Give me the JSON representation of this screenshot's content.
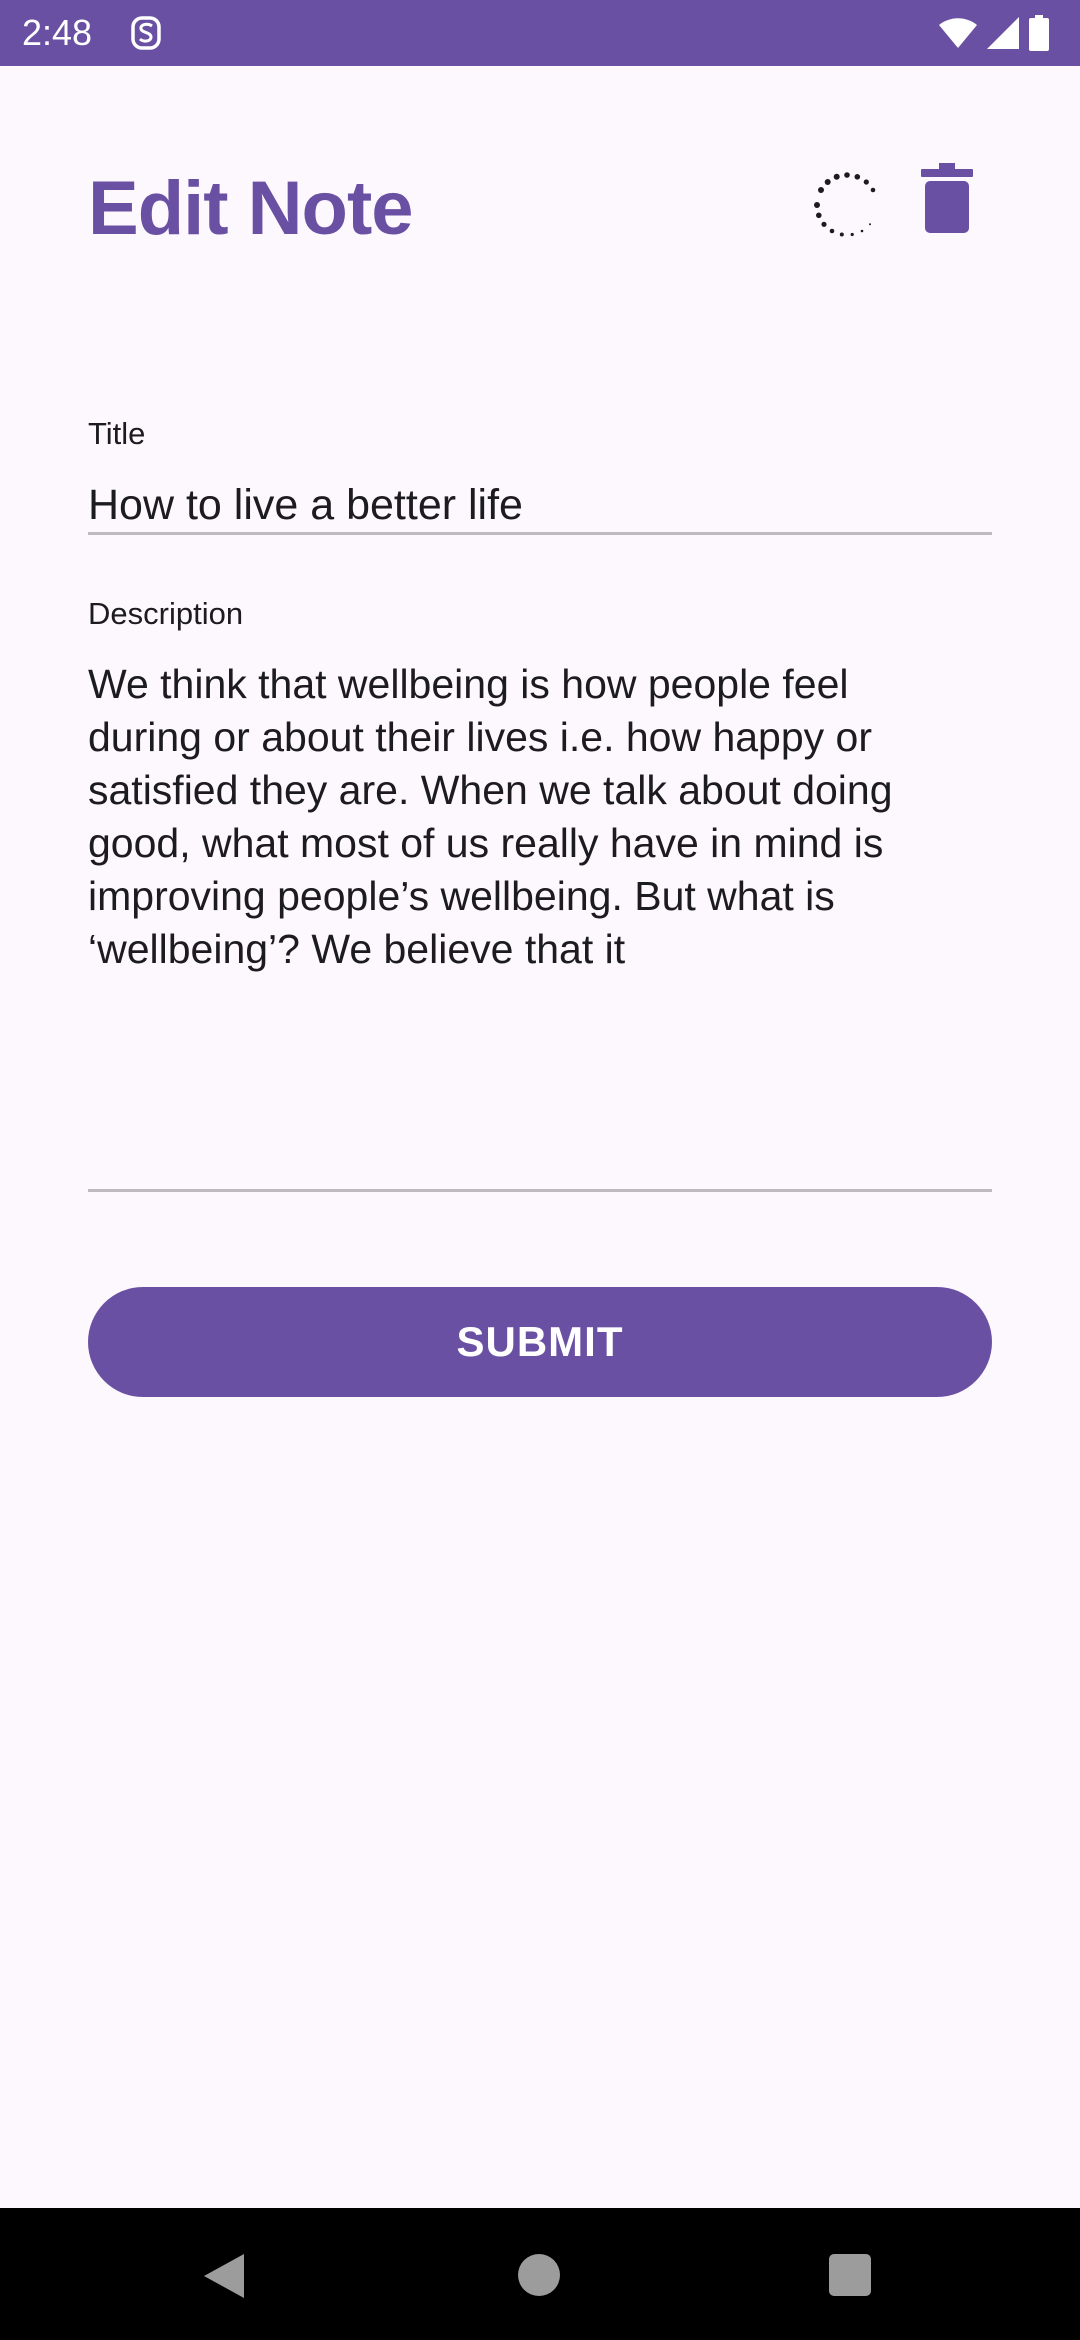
{
  "status_bar": {
    "time": "2:48",
    "app_icon": "s-notification-icon",
    "icons": [
      "wifi-icon",
      "cell-signal-icon",
      "battery-icon"
    ],
    "color": "#6a50a3"
  },
  "header": {
    "title": "Edit Note",
    "loading_indicator": "spinner-icon",
    "delete_icon": "trash-icon"
  },
  "form": {
    "title_label": "Title",
    "title_value": "How to live a better life",
    "description_label": "Description",
    "description_value": "We think that wellbeing is how people feel\nduring or about their lives i.e. how happy or\nsatisfied they are. When we talk about doing\ngood, what most of us really have in mind is\nimproving people’s wellbeing. But what is\n‘wellbeing’? We believe that it"
  },
  "submit_label": "SUBMIT",
  "nav_bar": {
    "buttons": [
      "back-icon",
      "home-icon",
      "recents-icon"
    ]
  },
  "colors": {
    "accent": "#6a50a3",
    "background": "#fdf8fd",
    "text": "#1c1b1f"
  }
}
